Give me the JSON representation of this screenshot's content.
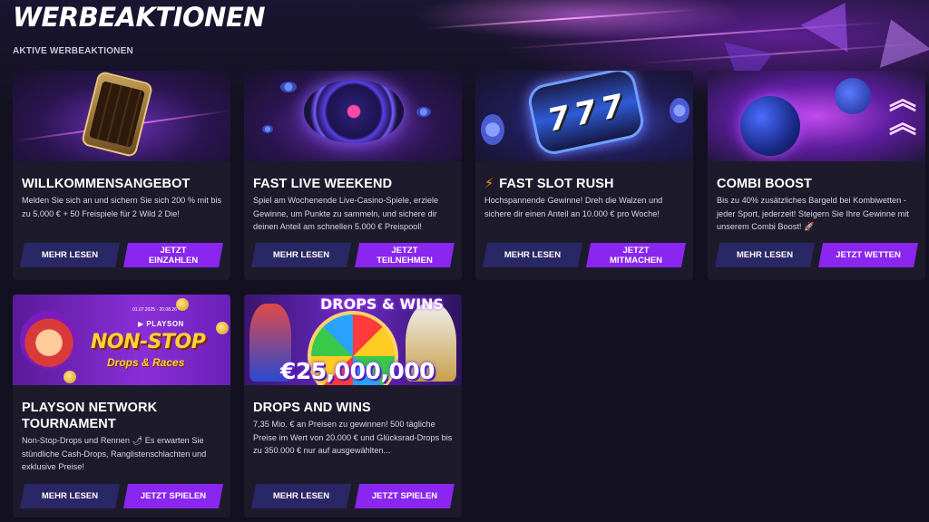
{
  "page": {
    "title": "WERBEAKTIONEN",
    "section_label": "AKTIVE WERBEAKTIONEN"
  },
  "promotions": [
    {
      "title": "WILLKOMMENSANGEBOT",
      "description": "Melden Sie sich an und sichern Sie sich 200 % mit bis zu 5.000 € + 50 Freispiele für 2 Wild 2 Die!",
      "secondary_label": "MEHR LESEN",
      "primary_label": "JETZT EINZAHLEN"
    },
    {
      "title": "FAST LIVE WEEKEND",
      "description": "Spiel am Wochenende Live-Casino-Spiele, erziele Gewinne, um Punkte zu sammeln, und sichere dir deinen Anteil am schnellen 5.000 € Preispool!",
      "secondary_label": "MEHR LESEN",
      "primary_label": "JETZT TEILNEHMEN"
    },
    {
      "title": "FAST SLOT RUSH",
      "title_icon": "lightning-icon",
      "description": "Hochspannende Gewinne! Dreh die Walzen und sichere dir einen Anteil an 10.000 € pro Woche!",
      "secondary_label": "MEHR LESEN",
      "primary_label": "JETZT MITMACHEN"
    },
    {
      "title": "COMBI BOOST",
      "description": "Bis zu 40% zusätzliches Bargeld bei Kombiwetten - jeder Sport, jederzeit! Steigern Sie Ihre Gewinne mit unserem Combi Boost! 🚀",
      "secondary_label": "MEHR LESEN",
      "primary_label": "JETZT WETTEN"
    },
    {
      "title": "PLAYSON NETWORK TOURNAMENT",
      "description": "Non-Stop-Drops und Rennen 🌶 Es erwarten Sie stündliche Cash-Drops, Ranglistenschlachten und exklusive Preise!",
      "secondary_label": "MEHR LESEN",
      "primary_label": "JETZT SPIELEN",
      "banner": {
        "dates": "01.07.2025 - 20.08.26",
        "brand": "▶ PLAYSON",
        "headline": "NON-STOP",
        "subline": "Drops & Races"
      }
    },
    {
      "title": "DROPS AND WINS",
      "description": "7,35 Mio. € an Preisen zu gewinnen! 500 tägliche Preise im Wert von 20.000 € und Glücksrad-Drops bis zu 350.000 € nur auf ausgewählten...",
      "secondary_label": "MEHR LESEN",
      "primary_label": "JETZT SPIELEN",
      "banner": {
        "logo": "DROPS & WINS",
        "prize": "€25,000,000"
      }
    }
  ],
  "colors": {
    "background": "#13111f",
    "card": "#1d1b2b",
    "primary_button": "#8a26ef",
    "secondary_button": "#2a2766"
  }
}
